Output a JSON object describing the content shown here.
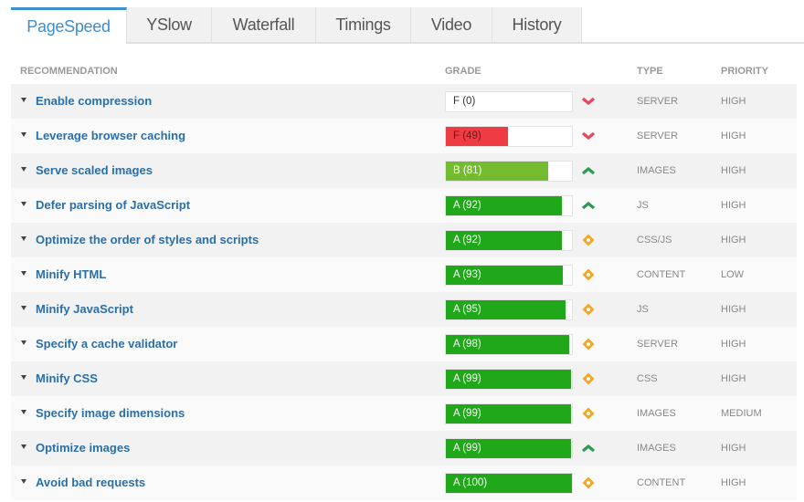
{
  "tabs": [
    "PageSpeed",
    "YSlow",
    "Waterfall",
    "Timings",
    "Video",
    "History"
  ],
  "headers": {
    "recommendation": "RECOMMENDATION",
    "grade": "GRADE",
    "type": "TYPE",
    "priority": "PRIORITY"
  },
  "colors": {
    "red": "#ee3b44",
    "lightgreen": "#74bb2f",
    "green": "#21a81a",
    "accent": "#3d8fd1"
  },
  "rows": [
    {
      "name": "Enable compression",
      "grade": "F (0)",
      "score": 0,
      "color": "red",
      "icon": "chevron-down",
      "type": "SERVER",
      "priority": "HIGH"
    },
    {
      "name": "Leverage browser caching",
      "grade": "F (49)",
      "score": 49,
      "color": "red",
      "icon": "chevron-down",
      "type": "SERVER",
      "priority": "HIGH"
    },
    {
      "name": "Serve scaled images",
      "grade": "B (81)",
      "score": 81,
      "color": "lightgreen",
      "icon": "chevron-up",
      "type": "IMAGES",
      "priority": "HIGH"
    },
    {
      "name": "Defer parsing of JavaScript",
      "grade": "A (92)",
      "score": 92,
      "color": "green",
      "icon": "chevron-up",
      "type": "JS",
      "priority": "HIGH"
    },
    {
      "name": "Optimize the order of styles and scripts",
      "grade": "A (92)",
      "score": 92,
      "color": "green",
      "icon": "diamond",
      "type": "CSS/JS",
      "priority": "HIGH"
    },
    {
      "name": "Minify HTML",
      "grade": "A (93)",
      "score": 93,
      "color": "green",
      "icon": "diamond",
      "type": "CONTENT",
      "priority": "LOW"
    },
    {
      "name": "Minify JavaScript",
      "grade": "A (95)",
      "score": 95,
      "color": "green",
      "icon": "diamond",
      "type": "JS",
      "priority": "HIGH"
    },
    {
      "name": "Specify a cache validator",
      "grade": "A (98)",
      "score": 98,
      "color": "green",
      "icon": "diamond",
      "type": "SERVER",
      "priority": "HIGH"
    },
    {
      "name": "Minify CSS",
      "grade": "A (99)",
      "score": 99,
      "color": "green",
      "icon": "diamond",
      "type": "CSS",
      "priority": "HIGH"
    },
    {
      "name": "Specify image dimensions",
      "grade": "A (99)",
      "score": 99,
      "color": "green",
      "icon": "diamond",
      "type": "IMAGES",
      "priority": "MEDIUM"
    },
    {
      "name": "Optimize images",
      "grade": "A (99)",
      "score": 99,
      "color": "green",
      "icon": "chevron-up",
      "type": "IMAGES",
      "priority": "HIGH"
    },
    {
      "name": "Avoid bad requests",
      "grade": "A (100)",
      "score": 100,
      "color": "green",
      "icon": "diamond",
      "type": "CONTENT",
      "priority": "HIGH"
    }
  ]
}
